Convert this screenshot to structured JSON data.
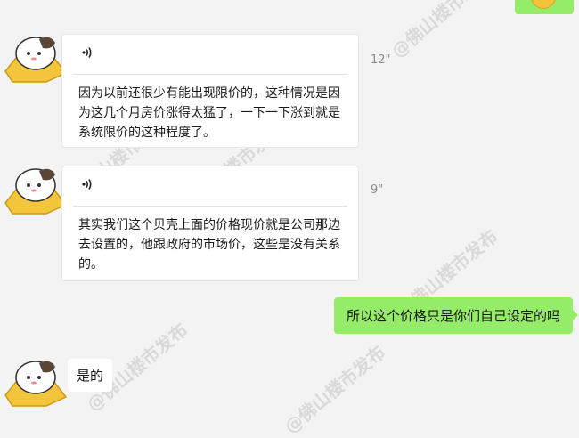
{
  "colors": {
    "background": "#f3f3f3",
    "incoming_bubble": "#ffffff",
    "outgoing_bubble": "#95ec69"
  },
  "watermark": "@佛山楼市发布",
  "messages": [
    {
      "kind": "voice",
      "sender": "other",
      "icon": "voice-wave-icon",
      "duration": "12\"",
      "transcript": "因为以前还很少有能出现限价的，这种情况是因为这几个月房价涨得太猛了，一下一下涨到就是系统限价的这种程度了。"
    },
    {
      "kind": "voice",
      "sender": "other",
      "icon": "voice-wave-icon",
      "duration": "9\"",
      "transcript": "其实我们这个贝壳上面的价格现价就是公司那边去设置的，他跟政府的市场价，这些是没有关系的。"
    },
    {
      "kind": "text",
      "sender": "me",
      "text": "所以这个价格只是你们自己设定的吗"
    },
    {
      "kind": "text",
      "sender": "other",
      "text": "是的"
    }
  ]
}
